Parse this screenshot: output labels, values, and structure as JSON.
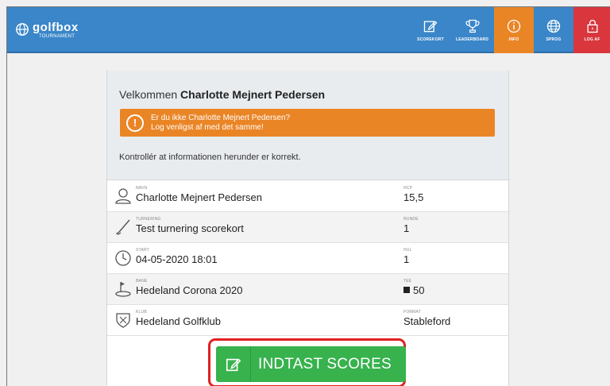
{
  "brand": {
    "name": "golfbox",
    "sub": "TOURNAMENT"
  },
  "nav": [
    {
      "label": "SCOREKORT",
      "icon": "scorecard-icon"
    },
    {
      "label": "LEADERBOARD",
      "icon": "trophy-icon"
    },
    {
      "label": "INFO",
      "icon": "info-icon",
      "active": true
    },
    {
      "label": "SPROG",
      "icon": "globe-icon"
    },
    {
      "label": "LOG AF",
      "icon": "lock-icon"
    }
  ],
  "colors": {
    "topbar": "#3a86c9",
    "info_active": "#ea8526",
    "logout": "#d9363e",
    "alert": "#ea8526",
    "primary_button": "#37b24d",
    "highlight": "#e02020"
  },
  "welcome": {
    "prefix": "Velkommen",
    "name": "Charlotte Mejnert Pedersen"
  },
  "alert": {
    "line1": "Er du ikke Charlotte Mejnert Pedersen?",
    "line2": "Log venligst af med det samme!"
  },
  "check_text": "Kontrollér at informationen herunder er korrekt.",
  "info_rows": [
    {
      "icon": "person-icon",
      "label1": "NAVN",
      "value1": "Charlotte Mejnert Pedersen",
      "label2": "HCP",
      "value2": "15,5"
    },
    {
      "icon": "golf-club-icon",
      "label1": "TURNERING",
      "value1": "Test turnering scorekort",
      "label2": "RUNDE",
      "value2": "1"
    },
    {
      "icon": "clock-icon",
      "label1": "START",
      "value1": "04-05-2020 18:01",
      "label2": "HUL",
      "value2": "1"
    },
    {
      "icon": "golf-flag-icon",
      "label1": "BANE",
      "value1": "Hedeland Corona 2020",
      "label2": "TEE",
      "value2": "50"
    },
    {
      "icon": "club-shield-icon",
      "label1": "KLUB",
      "value1": "Hedeland Golfklub",
      "label2": "FORMAT",
      "value2": "Stableford"
    }
  ],
  "cta": {
    "label": "INDTAST SCORES",
    "icon": "edit-scorecard-icon"
  }
}
